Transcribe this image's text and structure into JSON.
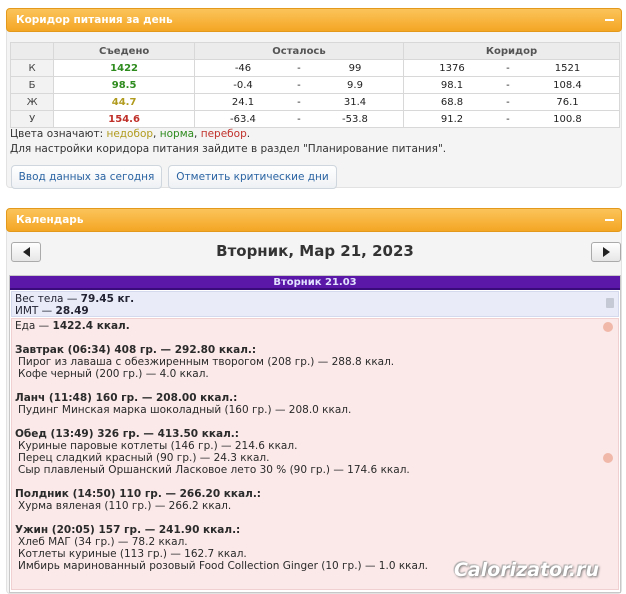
{
  "corridor_panel": {
    "title": "Коридор питания за день",
    "headers": {
      "label": "",
      "eaten": "Съедено",
      "remaining": "Осталось",
      "corridor": "Коридор"
    },
    "rows": [
      {
        "label": "К",
        "eaten": "1422",
        "eaten_status": "norm",
        "rem_min": "-46",
        "sep1": "-",
        "rem_max": "99",
        "cor_min": "1376",
        "sep2": "-",
        "cor_max": "1521"
      },
      {
        "label": "Б",
        "eaten": "98.5",
        "eaten_status": "norm",
        "rem_min": "-0.4",
        "sep1": "-",
        "rem_max": "9.9",
        "cor_min": "98.1",
        "sep2": "-",
        "cor_max": "108.4"
      },
      {
        "label": "Ж",
        "eaten": "44.7",
        "eaten_status": "low",
        "rem_min": "24.1",
        "sep1": "-",
        "rem_max": "31.4",
        "cor_min": "68.8",
        "sep2": "-",
        "cor_max": "76.1"
      },
      {
        "label": "У",
        "eaten": "154.6",
        "eaten_status": "over",
        "rem_min": "-63.4",
        "sep1": "-",
        "rem_max": "-53.8",
        "cor_min": "91.2",
        "sep2": "-",
        "cor_max": "100.8"
      }
    ],
    "legend_prefix": "Цвета означают: ",
    "legend_low": "недобор",
    "legend_comma1": ", ",
    "legend_norm": "норма",
    "legend_comma2": ", ",
    "legend_over": "перебор",
    "legend_end": ".",
    "settings_note": "Для настройки коридора питания зайдите в раздел \"Планирование питания\".",
    "btn_enter": "Ввод данных за сегодня",
    "btn_critical": "Отметить критические дни"
  },
  "calendar_panel": {
    "title": "Календарь",
    "date_title": "Вторник, Мар 21, 2023",
    "day_header": "Вторник 21.03",
    "weight_label": "Вес тела — ",
    "weight_value": "79.45 кг.",
    "bmi_label": "ИМТ — ",
    "bmi_value": "28.49",
    "food_label": "Еда — ",
    "food_value": "1422.4 ккал.",
    "meals": [
      {
        "title": "Завтрак (06:34) 408 гр. — 292.80 ккал.:",
        "items": [
          "Пирог из лаваша с обезжиренным творогом (208 гр.) — 288.8 ккал.",
          "Кофе черный (200 гр.) — 4.0 ккал."
        ]
      },
      {
        "title": "Ланч (11:48) 160 гр. — 208.00 ккал.:",
        "items": [
          "Пудинг Минская марка шоколадный (160 гр.) — 208.0 ккал."
        ]
      },
      {
        "title": "Обед (13:49) 326 гр. — 413.50 ккал.:",
        "items": [
          "Куриные паровые котлеты (146 гр.) — 214.6 ккал.",
          "Перец сладкий красный (90 гр.) — 24.3 ккал.",
          "Сыр плавленый Оршанский Ласковое лето 30 % (90 гр.) — 174.6 ккал."
        ]
      },
      {
        "title": "Полдник (14:50) 110 гр. — 266.20 ккал.:",
        "items": [
          "Хурма вяленая (110 гр.) — 266.2 ккал."
        ]
      },
      {
        "title": "Ужин (20:05) 157 гр. — 241.90 ккал.:",
        "items": [
          "Хлеб МАГ (34 гр.) — 78.2 ккал.",
          "Котлеты куриные (113 гр.) — 162.7 ккал.",
          "Имбирь маринованный розовый Food Collection Ginger (10 гр.) — 1.0 ккал."
        ]
      }
    ]
  },
  "watermark": "Calorizator.ru",
  "colors": {
    "accent": "#f4a624",
    "low": "#b19b1e",
    "norm": "#2e8b1e",
    "over": "#c0302a",
    "day_header": "#5b18a8"
  }
}
